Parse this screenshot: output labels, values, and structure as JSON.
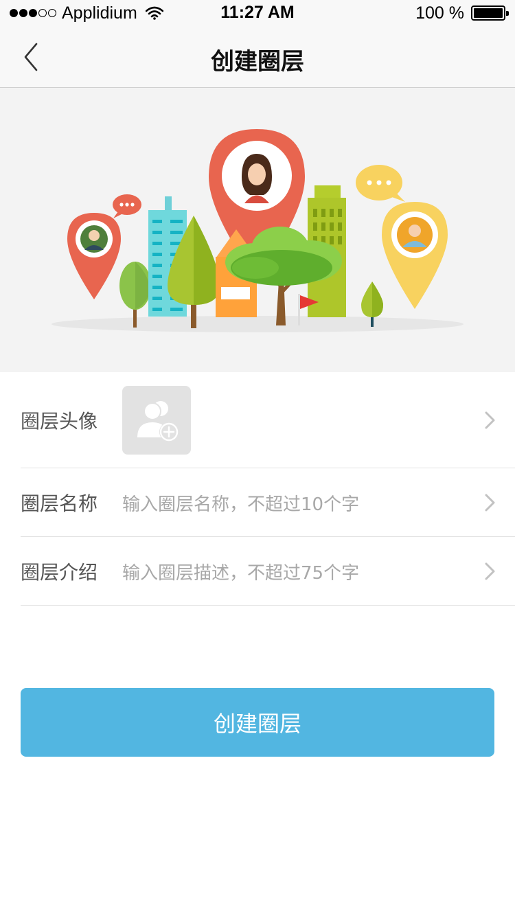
{
  "status_bar": {
    "carrier": "Applidium",
    "time": "11:27 AM",
    "battery": "100 %"
  },
  "nav": {
    "title": "创建圈层",
    "back_icon": "chevron-left-icon"
  },
  "form": {
    "avatar": {
      "label": "圈层头像",
      "icon": "add-group-avatar-icon"
    },
    "name": {
      "label": "圈层名称",
      "placeholder": "输入圈层名称，不超过10个字"
    },
    "intro": {
      "label": "圈层介绍",
      "placeholder": "输入圈层描述，不超过75个字"
    }
  },
  "create_button": {
    "label": "创建圈层"
  },
  "colors": {
    "accent": "#52b6e1",
    "pin_red": "#e8654f",
    "pin_yellow": "#f5cf5c"
  }
}
